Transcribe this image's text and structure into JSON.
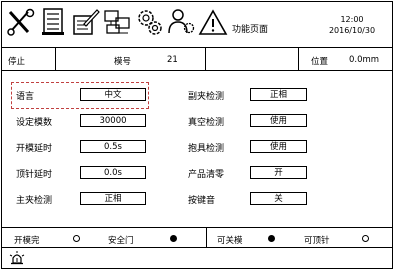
{
  "header": {
    "icons": [
      "tools-icon",
      "document-icon",
      "edit-document-icon",
      "computer-network-icon",
      "settings-gears-icon",
      "user-settings-icon",
      "warning-icon"
    ],
    "title": "功能页面",
    "time": "12:00",
    "date": "2016/10/30"
  },
  "status": {
    "state": "停止",
    "mold_label": "模号",
    "mold_value": "21",
    "position_label": "位置",
    "position_value": "0.0mm"
  },
  "settings": {
    "left": [
      {
        "label": "语言",
        "value": "中文"
      },
      {
        "label": "设定模数",
        "value": "30000"
      },
      {
        "label": "开模延时",
        "value": "0.5s"
      },
      {
        "label": "顶针延时",
        "value": "0.0s"
      },
      {
        "label": "主夹检测",
        "value": "正相"
      }
    ],
    "right": [
      {
        "label": "副夹检测",
        "value": "正相"
      },
      {
        "label": "真空检测",
        "value": "使用"
      },
      {
        "label": "抱具检测",
        "value": "使用"
      },
      {
        "label": "产品清零",
        "value": "开"
      },
      {
        "label": "按键音",
        "value": "关"
      }
    ]
  },
  "io": [
    {
      "label": "开模完",
      "on": false
    },
    {
      "label": "安全门",
      "on": true
    },
    {
      "label": "可关模",
      "on": true
    },
    {
      "label": "可顶针",
      "on": false
    }
  ],
  "footer": {
    "icon": "alarm-icon"
  }
}
